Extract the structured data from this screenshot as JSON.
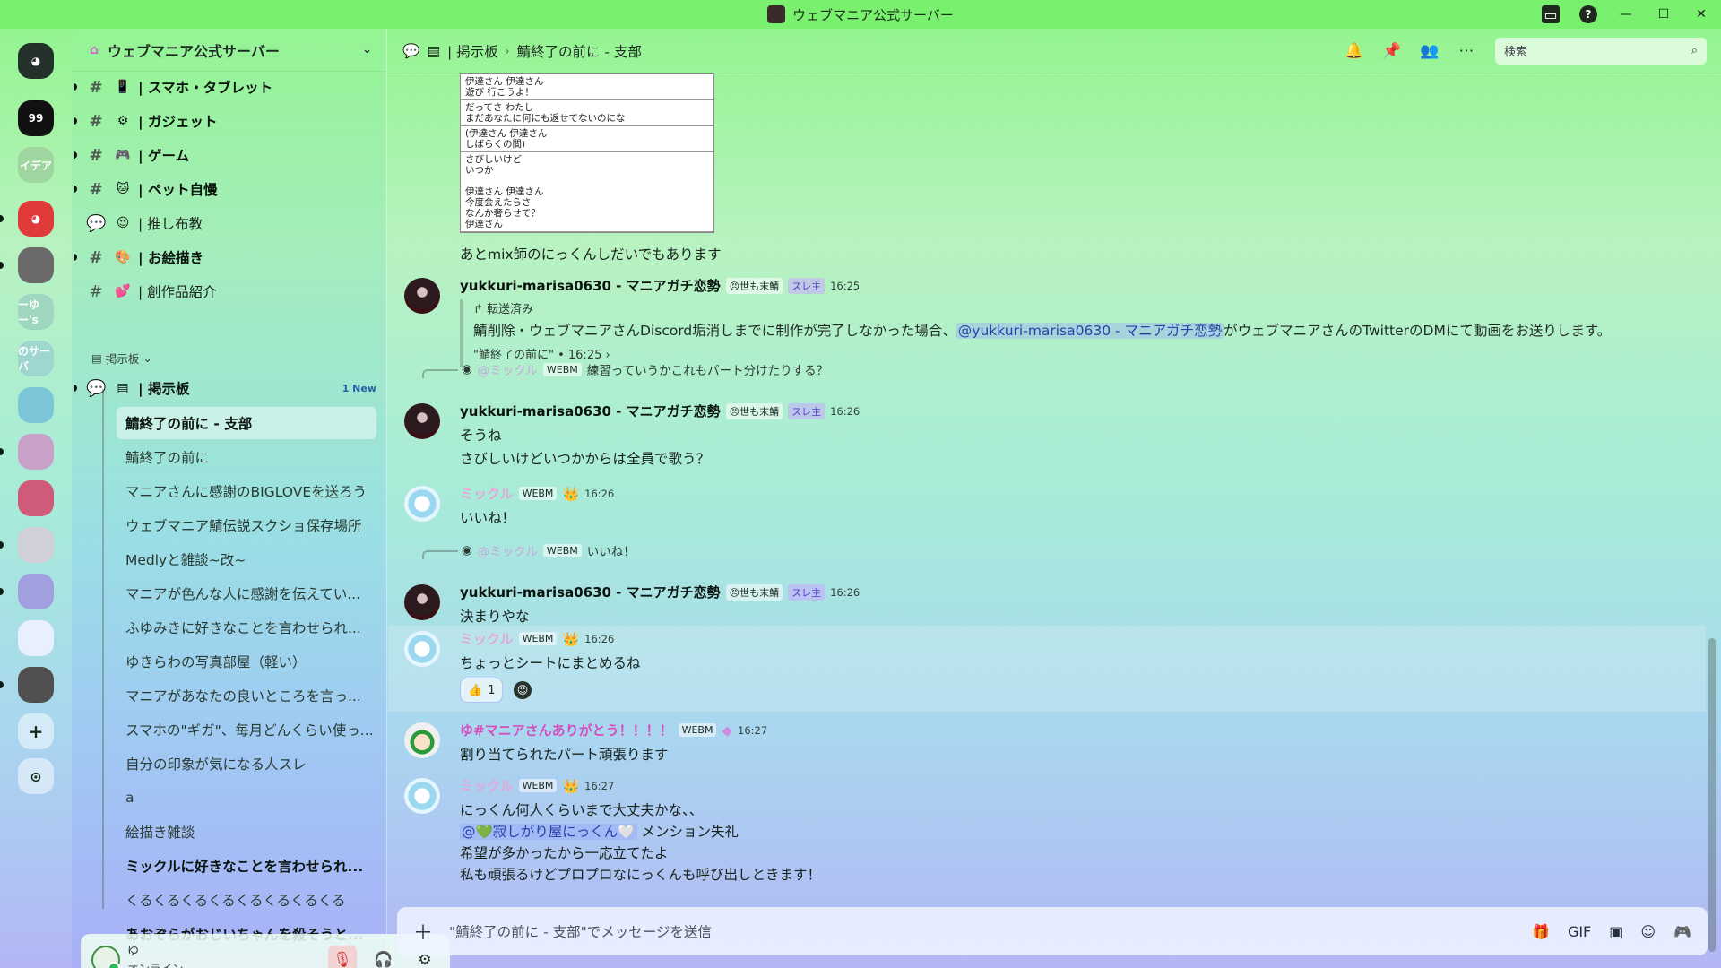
{
  "window": {
    "title": "ウェブマニア公式サーバー"
  },
  "rail": {
    "servers": [
      {
        "label": "",
        "color": "#24302a",
        "icon": "discord-logo-icon"
      },
      {
        "label": "99",
        "color": "#111111"
      },
      {
        "label": "イデア",
        "color": "#9fd6a0"
      },
      {
        "label": "",
        "color": "#e03a3a",
        "icon": "discord-logo-icon"
      },
      {
        "label": "",
        "color": "#6a6a6a"
      },
      {
        "label": "ーゆー's",
        "color": "#9fd6c0"
      },
      {
        "label": "のサーバ",
        "color": "#9fd6d0"
      },
      {
        "label": "",
        "color": "#7bc7d8"
      },
      {
        "label": "",
        "color": "#c8a0c8"
      },
      {
        "label": "",
        "color": "#d05a7a"
      },
      {
        "label": "",
        "color": "#d0d0d8"
      },
      {
        "label": "",
        "color": "#a0a0e0"
      },
      {
        "label": "",
        "color": "#e8f0ff"
      },
      {
        "label": "",
        "color": "#505050"
      }
    ]
  },
  "sidebar": {
    "server_name": "ウェブマニア公式サーバー",
    "channels": [
      {
        "emoji": "📱",
        "name": "| スマホ・タブレット",
        "bold": true
      },
      {
        "emoji": "⚙",
        "name": "| ガジェット",
        "bold": true
      },
      {
        "emoji": "🎮",
        "name": "| ゲーム",
        "bold": true
      },
      {
        "emoji": "🐱",
        "name": "| ペット自慢",
        "bold": true
      },
      {
        "emoji": "😍",
        "name": "| 推し布教",
        "bold": false
      },
      {
        "emoji": "🎨",
        "name": "| お絵描き",
        "bold": true
      },
      {
        "emoji": "💕",
        "name": "| 創作品紹介",
        "bold": false
      }
    ],
    "category": "掲示板",
    "forum": {
      "name": "| 掲示板",
      "badge": "1 New"
    },
    "threads": [
      {
        "name": "鯖終了の前に - 支部",
        "active": true,
        "bold": false
      },
      {
        "name": "鯖終了の前に",
        "active": false,
        "bold": false
      },
      {
        "name": "マニアさんに感謝のBIGLOVEを送ろう",
        "active": false,
        "bold": false
      },
      {
        "name": "ウェブマニア鯖伝説スクショ保存場所",
        "active": false,
        "bold": false
      },
      {
        "name": "Medlyと雑談~改~",
        "active": false,
        "bold": false
      },
      {
        "name": "マニアが色んな人に感謝を伝えてい...",
        "active": false,
        "bold": false
      },
      {
        "name": "ふゆみきに好きなことを言わせられ...",
        "active": false,
        "bold": false
      },
      {
        "name": "ゆきらわの写真部屋（軽い）",
        "active": false,
        "bold": false
      },
      {
        "name": "マニアがあなたの良いところを言っ...",
        "active": false,
        "bold": false
      },
      {
        "name": "スマホの\"ギガ\"、毎月どんくらい使っ...",
        "active": false,
        "bold": false
      },
      {
        "name": "自分の印象が気になる人スレ",
        "active": false,
        "bold": false
      },
      {
        "name": "a",
        "active": false,
        "bold": false
      },
      {
        "name": "絵描き雑談",
        "active": false,
        "bold": false
      },
      {
        "name": "ミックルに好きなことを言わせられ...",
        "active": false,
        "bold": true
      },
      {
        "name": "くるくるくるくるくるくるくるくる",
        "active": false,
        "bold": false
      },
      {
        "name": "あおぞらがおじいちゃんを殺そうと...",
        "active": false,
        "bold": true
      }
    ]
  },
  "user": {
    "name": "ゆ",
    "status": "オンライン"
  },
  "header": {
    "forum": "| 掲示板",
    "thread": "鯖終了の前に - 支部",
    "search_placeholder": "検索"
  },
  "lyrics": [
    "伊達さん 伊達さん\n遊び 行こうよ！",
    "だってさ わたし\nまだあなたに何にも返せてないのにな",
    "(伊達さん 伊達さん\nしばらくの間)",
    "さびしいけど\nいつか\n\n伊達さん 伊達さん\n今度会えたらさ\nなんか奢らせて？\n伊達さん"
  ],
  "messages": {
    "m0": {
      "text": "あとmix師のにっくんしだいでもあります"
    },
    "m1": {
      "author": "yukkuri-marisa0630 - マニアガチ恋勢",
      "tag": "世も末鯖",
      "role": "スレ主",
      "time": "16:25",
      "forwarded": "転送済み",
      "fwd_pre": "鯖削除・ウェブマニアさんDiscord垢消しまでに制作が完了しなかった場合、",
      "fwd_mention": "@yukkuri-marisa0630 - マニアガチ恋勢",
      "fwd_post": "がウェブマニアさんのTwitterのDMにて動画をお送りします。",
      "fwd_source": "\"鯖終了の前に\" • 16:25 ›"
    },
    "m2": {
      "reply_name": "@ミックル",
      "reply_tag": "WEBM",
      "reply_text": "練習っていうかこれもパート分けたりする？",
      "author": "yukkuri-marisa0630 - マニアガチ恋勢",
      "tag": "世も末鯖",
      "role": "スレ主",
      "time": "16:26",
      "line1": "そうね",
      "line2": "さびしいけどいつかからは全員で歌う？"
    },
    "m3": {
      "author": "ミックル",
      "tag": "WEBM",
      "time": "16:26",
      "text": "いいね！"
    },
    "m4": {
      "reply_name": "@ミックル",
      "reply_tag": "WEBM",
      "reply_text": "いいね！",
      "author": "yukkuri-marisa0630 - マニアガチ恋勢",
      "tag": "世も末鯖",
      "role": "スレ主",
      "time": "16:26",
      "text": "決まりやな"
    },
    "m5": {
      "author": "ミックル",
      "tag": "WEBM",
      "time": "16:26",
      "text": "ちょっとシートにまとめるね",
      "reaction_emoji": "👍",
      "reaction_count": "1"
    },
    "m6": {
      "author": "ゆ#マニアさんありがとう！！！！",
      "tag": "WEBM",
      "time": "16:27",
      "text": "割り当てられたパート頑張ります"
    },
    "m7": {
      "author": "ミックル",
      "tag": "WEBM",
      "time": "16:27",
      "line1": "にっくん何人くらいまで大丈夫かな、、",
      "mention": "@💚寂しがり屋にっくん🤍",
      "line2_post": " メンション失礼",
      "line3": "希望が多かったから一応立てたよ",
      "line4": "私も頑張るけどプロプロなにっくんも呼び出しときます！"
    }
  },
  "composer": {
    "placeholder": "\"鯖終了の前に - 支部\"でメッセージを送信"
  },
  "colors": {
    "accent": "#5865f2",
    "titlebar": "#79f06e",
    "online": "#2dbb5a"
  }
}
